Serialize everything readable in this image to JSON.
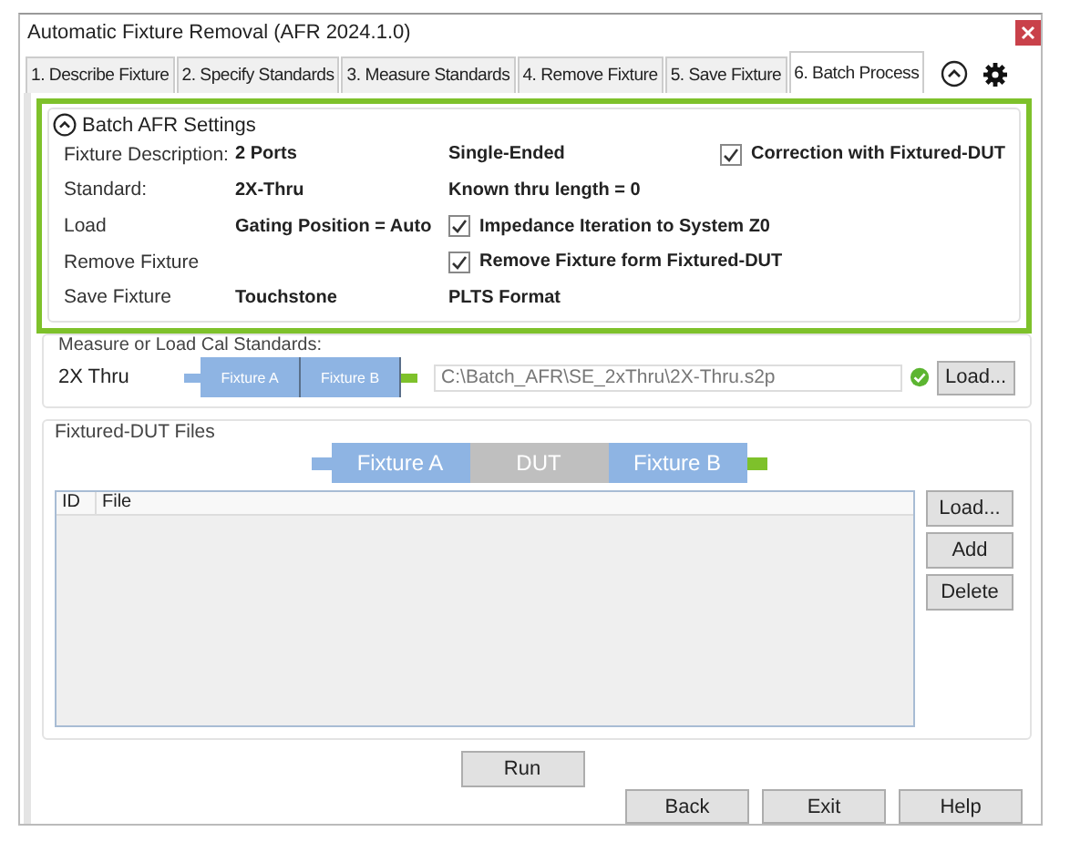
{
  "window": {
    "title": "Automatic Fixture Removal (AFR 2024.1.0)"
  },
  "tabs": [
    {
      "label": "1. Describe Fixture",
      "selected": false
    },
    {
      "label": "2. Specify Standards",
      "selected": false
    },
    {
      "label": "3. Measure Standards",
      "selected": false
    },
    {
      "label": "4. Remove Fixture",
      "selected": false
    },
    {
      "label": "5. Save Fixture",
      "selected": false
    },
    {
      "label": "6. Batch Process",
      "selected": true
    }
  ],
  "settings": {
    "title": "Batch AFR Settings",
    "expanded": true,
    "rows": [
      {
        "label": "Fixture Description:",
        "value": "2 Ports",
        "detail": {
          "kind": "text",
          "text": "Single-Ended"
        },
        "extra": {
          "kind": "check",
          "text": "Correction with Fixtured-DUT",
          "checked": true
        }
      },
      {
        "label": "Standard:",
        "value": "2X-Thru",
        "detail": {
          "kind": "text",
          "text": "Known thru length = 0"
        }
      },
      {
        "label": "Load",
        "value": "Gating Position = Auto",
        "detail": {
          "kind": "check",
          "text": "Impedance Iteration to System Z0",
          "checked": true
        }
      },
      {
        "label": "Remove Fixture",
        "detail": {
          "kind": "check",
          "text": "Remove Fixture form Fixtured-DUT",
          "checked": true
        }
      },
      {
        "label": "Save Fixture",
        "value": "Touchstone",
        "detail": {
          "kind": "text",
          "text": "PLTS Format"
        }
      }
    ]
  },
  "cal_standards": {
    "title": "Measure or Load Cal Standards:",
    "label": "2X Thru",
    "blocks": [
      {
        "kind": "fixture",
        "text": "Fixture A"
      },
      {
        "kind": "fixture",
        "text": "Fixture B"
      }
    ],
    "path": "C:\\Batch_AFR\\SE_2xThru\\2X-Thru.s2p",
    "loaded": true,
    "button": "Load..."
  },
  "dut_files": {
    "title": "Fixtured-DUT Files",
    "blocks": [
      {
        "kind": "fixture",
        "text": "Fixture A"
      },
      {
        "kind": "dut",
        "text": "DUT"
      },
      {
        "kind": "fixture",
        "text": "Fixture B"
      }
    ],
    "columns": [
      "ID",
      "File"
    ],
    "buttons": [
      "Load...",
      "Add",
      "Delete"
    ]
  },
  "run_button": "Run",
  "nav_buttons": [
    "Back",
    "Exit",
    "Help"
  ]
}
